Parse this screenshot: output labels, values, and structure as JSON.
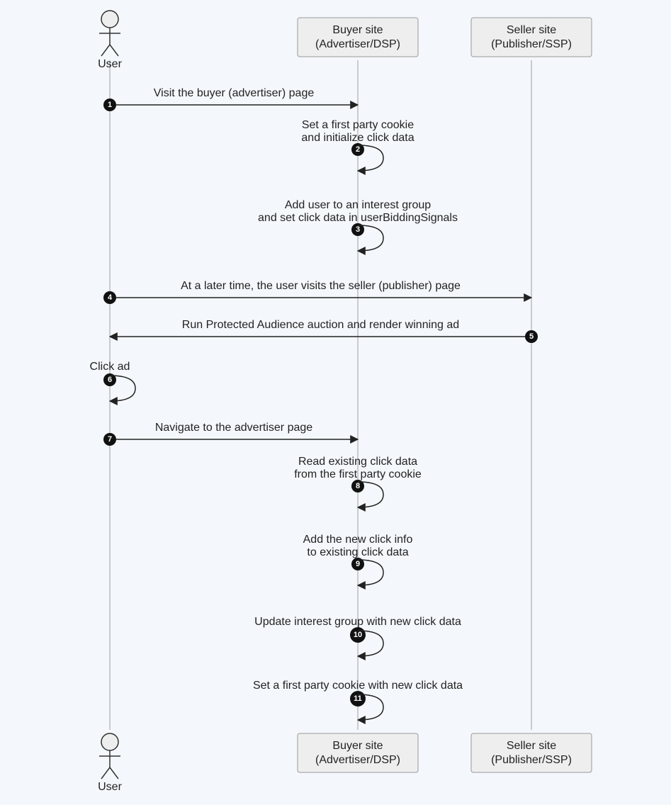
{
  "chart_data": {
    "type": "sequence-diagram",
    "participants": [
      {
        "id": "user",
        "label_line1": "User",
        "label_line2": ""
      },
      {
        "id": "buyer",
        "label_line1": "Buyer site",
        "label_line2": "(Advertiser/DSP)"
      },
      {
        "id": "seller",
        "label_line1": "Seller site",
        "label_line2": "(Publisher/SSP)"
      }
    ],
    "messages": [
      {
        "n": 1,
        "from": "user",
        "to": "buyer",
        "text1": "Visit the buyer (advertiser) page",
        "text2": ""
      },
      {
        "n": 2,
        "from": "buyer",
        "to": "buyer",
        "text1": "Set a first party cookie",
        "text2": "and initialize click data"
      },
      {
        "n": 3,
        "from": "buyer",
        "to": "buyer",
        "text1": "Add user to an interest group",
        "text2": "and set click data in userBiddingSignals"
      },
      {
        "n": 4,
        "from": "user",
        "to": "seller",
        "text1": "At a later time, the user visits the seller (publisher) page",
        "text2": ""
      },
      {
        "n": 5,
        "from": "seller",
        "to": "user",
        "text1": "Run Protected Audience auction and render winning ad",
        "text2": ""
      },
      {
        "n": 6,
        "from": "user",
        "to": "user",
        "text1": "Click ad",
        "text2": ""
      },
      {
        "n": 7,
        "from": "user",
        "to": "buyer",
        "text1": "Navigate to the advertiser page",
        "text2": ""
      },
      {
        "n": 8,
        "from": "buyer",
        "to": "buyer",
        "text1": "Read existing click data",
        "text2": "from the first party cookie"
      },
      {
        "n": 9,
        "from": "buyer",
        "to": "buyer",
        "text1": "Add the new click info",
        "text2": "to existing click data"
      },
      {
        "n": 10,
        "from": "buyer",
        "to": "buyer",
        "text1": "Update interest group with new click data",
        "text2": ""
      },
      {
        "n": 11,
        "from": "buyer",
        "to": "buyer",
        "text1": "Set a first party cookie with new click data",
        "text2": ""
      }
    ]
  }
}
